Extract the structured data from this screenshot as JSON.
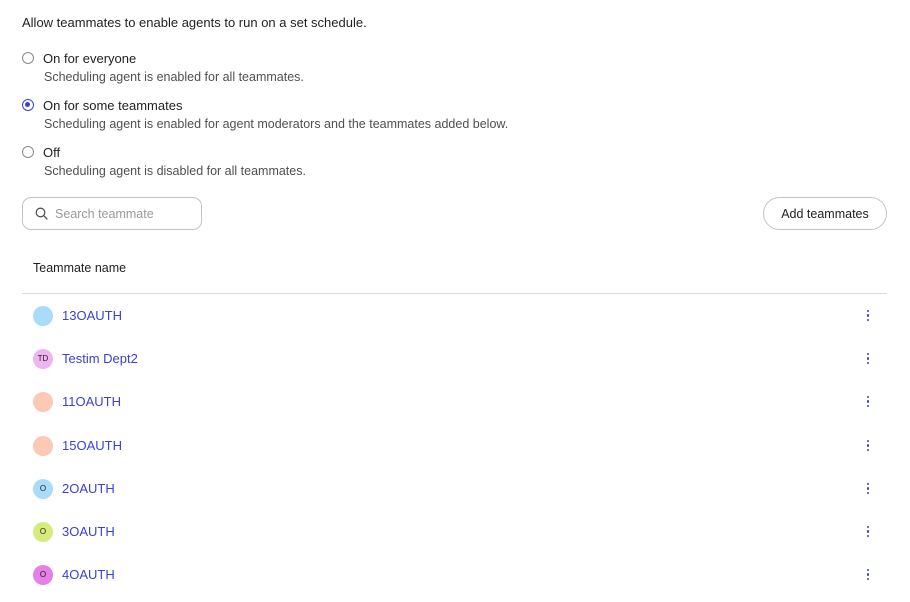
{
  "intro_text": "Allow teammates to enable agents to run on a set schedule.",
  "options": [
    {
      "label": "On for everyone",
      "description": "Scheduling agent is enabled for all teammates.",
      "checked": false
    },
    {
      "label": "On for some teammates",
      "description": "Scheduling agent is enabled for agent moderators and the teammates added below.",
      "checked": true
    },
    {
      "label": "Off",
      "description": "Scheduling agent is disabled for all teammates.",
      "checked": false
    }
  ],
  "search": {
    "placeholder": "Search teammate",
    "icon": "search-icon"
  },
  "add_button_label": "Add teammates",
  "table": {
    "column_header": "Teammate name",
    "rows": [
      {
        "name": "13OAUTH",
        "initials": "",
        "avatar_color": "#a8dcfa"
      },
      {
        "name": "Testim Dept2",
        "initials": "TD",
        "avatar_color": "#f0b4f0"
      },
      {
        "name": "11OAUTH",
        "initials": "",
        "avatar_color": "#fbc9b4"
      },
      {
        "name": "15OAUTH",
        "initials": "",
        "avatar_color": "#fbc9b4"
      },
      {
        "name": "2OAUTH",
        "initials": "O",
        "avatar_color": "#a8dcfa"
      },
      {
        "name": "3OAUTH",
        "initials": "O",
        "avatar_color": "#d6ec7a"
      },
      {
        "name": "4OAUTH",
        "initials": "O",
        "avatar_color": "#e67fe6"
      }
    ]
  },
  "colors": {
    "accent": "#3a3fd6"
  }
}
